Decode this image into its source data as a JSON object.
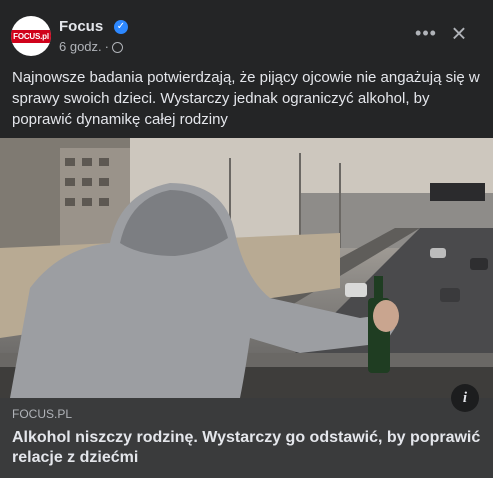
{
  "post": {
    "page_name": "Focus",
    "avatar_logo_text": "FOCUS.pl",
    "time": "6 godz.",
    "more_icon": "more-horizontal-icon",
    "close_icon": "close-icon",
    "text": "Najnowsze badania potwierdzają, że pijący ojcowie nie angażują się w sprawy swoich dzieci. Wystarczy jednak ograniczyć alkohol, by poprawić dynamikę całej rodziny"
  },
  "link_preview": {
    "domain": "FOCUS.PL",
    "headline": "Alkohol niszczy rodzinę. Wystarczy go odstawić, by poprawić relacje z dziećmi",
    "info_icon": "i"
  },
  "colors": {
    "background": "#242526",
    "link_card": "#3a3b3c",
    "text_primary": "#e4e6eb",
    "text_secondary": "#b0b3b8",
    "verified_blue": "#2d88ff",
    "brand_red": "#d0021b"
  }
}
